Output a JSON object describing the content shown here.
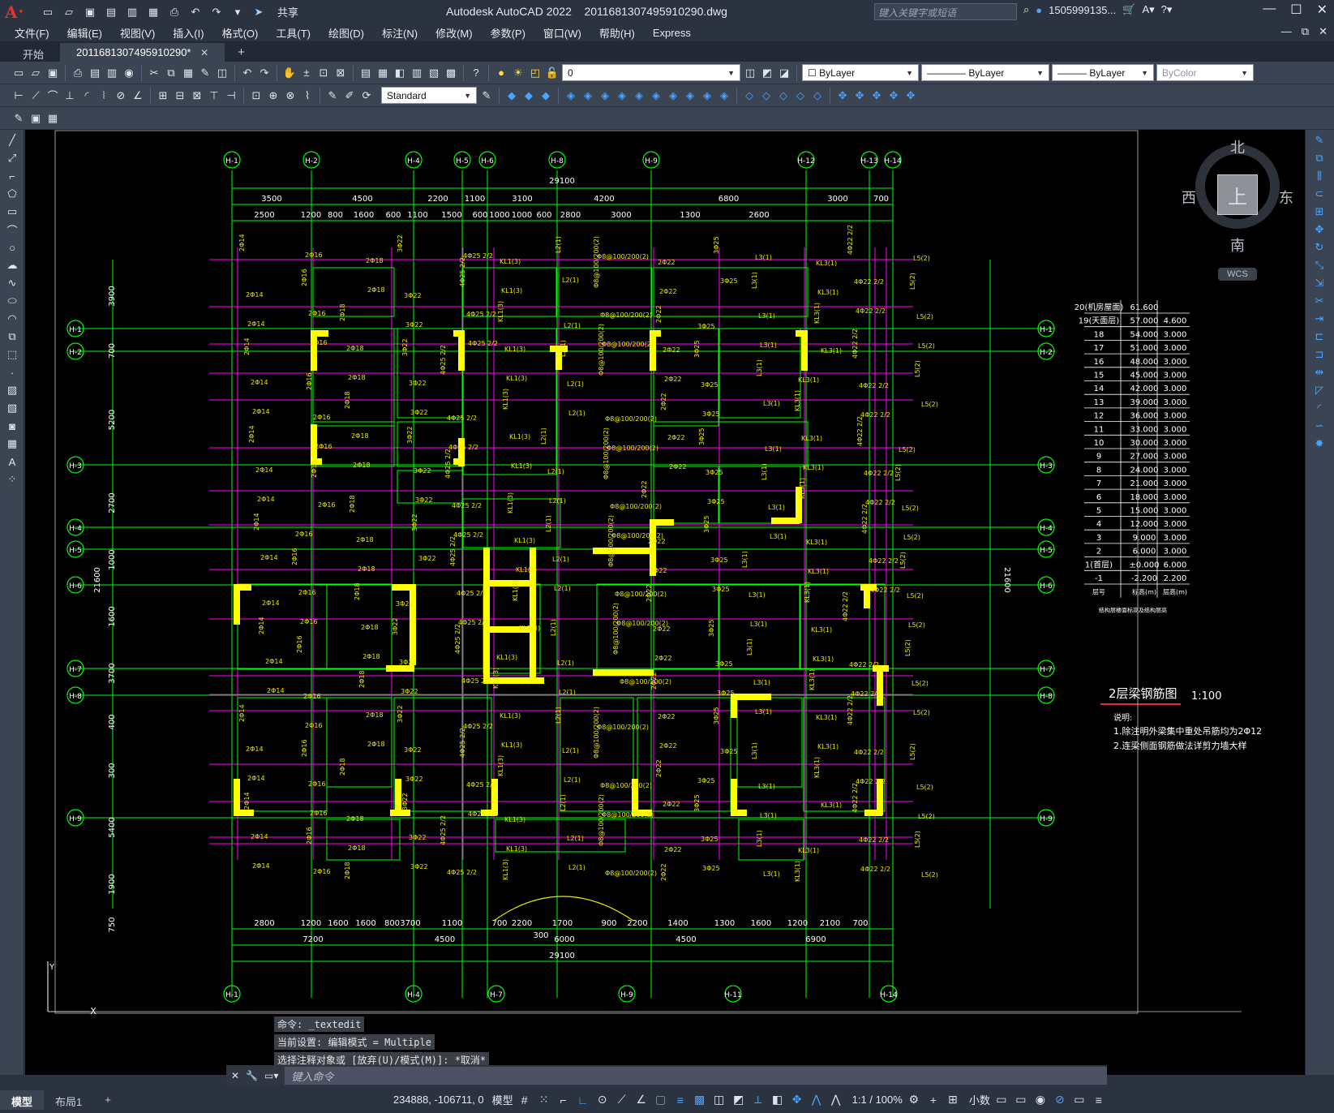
{
  "title_bar": {
    "app_title": "Autodesk AutoCAD 2022",
    "file_name": "2011681307495910290.dwg",
    "share_label": "共享",
    "search_placeholder": "键入关键字或短语",
    "user_name": "1505999135..."
  },
  "menu": {
    "items": [
      "文件(F)",
      "编辑(E)",
      "视图(V)",
      "插入(I)",
      "格式(O)",
      "工具(T)",
      "绘图(D)",
      "标注(N)",
      "修改(M)",
      "参数(P)",
      "窗口(W)",
      "帮助(H)",
      "Express"
    ]
  },
  "tabs": {
    "start": "开始",
    "drawing": "2011681307495910290*",
    "close": "✕",
    "add": "+"
  },
  "layers": {
    "current_layer": "0",
    "color": "ByLayer",
    "linetype": "ByLayer",
    "lineweight": "ByLayer",
    "plotstyle": "ByColor",
    "dimstyle": "Standard"
  },
  "viewcube": {
    "north": "北",
    "south": "南",
    "east": "东",
    "west": "西",
    "top": "上",
    "wcs": "WCS"
  },
  "drawing": {
    "axis_labels_top": [
      "H-1",
      "H-2",
      "H-4",
      "H-5",
      "H-6",
      "H-8",
      "H-9",
      "H-12",
      "H-13",
      "H-14"
    ],
    "axis_labels_bottom": [
      "H-1",
      "H-4",
      "H-7",
      "H-9",
      "H-11",
      "H-14"
    ],
    "axis_labels_left": [
      "H-1",
      "H-2",
      "H-3",
      "H-4",
      "H-5",
      "H-6",
      "H-7",
      "H-8",
      "H-9"
    ],
    "top_total": "29100",
    "top_dims_1": [
      "3500",
      "4500",
      "2200",
      "1100",
      "3100",
      "4200",
      "6800",
      "3000",
      "700"
    ],
    "top_dims_2": [
      "2500",
      "1200",
      "800",
      "1600",
      "600",
      "1100",
      "1500",
      "600",
      "1000",
      "1000",
      "600",
      "2800",
      "3000",
      "1300",
      "2600"
    ],
    "bottom_dims_1": [
      "2800",
      "1200",
      "1600",
      "1600",
      "800",
      "3700",
      "1100",
      "700",
      "2200",
      "1700",
      "900",
      "2200",
      "1400",
      "1300",
      "1600",
      "1200",
      "2100",
      "700"
    ],
    "bottom_dims_2": [
      "7200",
      "4500",
      "6000",
      "4500",
      "6900"
    ],
    "bottom_mid": "300",
    "bottom_total": "29100",
    "left_dims": [
      "3900",
      "700",
      "5200",
      "2700",
      "1000",
      "1600",
      "3700",
      "400",
      "300",
      "5400",
      "1900",
      "750"
    ],
    "left_total": "21600",
    "right_total": "21600",
    "title_text": "2层梁钢筋图",
    "title_scale": "1:100",
    "notes_heading": "说明:",
    "notes": [
      "1.除注明外梁集中重处吊筋均为2Φ12",
      "2.连梁侧面钢筋做法详剪力墙大样"
    ],
    "floor_table": {
      "rows": [
        [
          "20(机房屋面)",
          "61.600",
          ""
        ],
        [
          "19(天面层)",
          "57.000",
          "4.600"
        ],
        [
          "18",
          "54.000",
          "3.000"
        ],
        [
          "17",
          "51.000",
          "3.000"
        ],
        [
          "16",
          "48.000",
          "3.000"
        ],
        [
          "15",
          "45.000",
          "3.000"
        ],
        [
          "14",
          "42.000",
          "3.000"
        ],
        [
          "13",
          "39.000",
          "3.000"
        ],
        [
          "12",
          "36.000",
          "3.000"
        ],
        [
          "11",
          "33.000",
          "3.000"
        ],
        [
          "10",
          "30.000",
          "3.000"
        ],
        [
          "9",
          "27.000",
          "3.000"
        ],
        [
          "8",
          "24.000",
          "3.000"
        ],
        [
          "7",
          "21.000",
          "3.000"
        ],
        [
          "6",
          "18.000",
          "3.000"
        ],
        [
          "5",
          "15.000",
          "3.000"
        ],
        [
          "4",
          "12.000",
          "3.000"
        ],
        [
          "3",
          "9.000",
          "3.000"
        ],
        [
          "2",
          "6.000",
          "3.000"
        ],
        [
          "1(首层)",
          "±0.000",
          "6.000"
        ],
        [
          "-1",
          "-2.200",
          "2.200"
        ]
      ],
      "footer": [
        "层号",
        "标高(m)",
        "层高(m)"
      ],
      "caption": "结构层楼面标高及结构层高"
    }
  },
  "command": {
    "history": [
      "命令: _textedit",
      "当前设置: 编辑模式 = Multiple",
      "选择注释对象或 [放弃(U)/模式(M)]: *取消*"
    ],
    "placeholder": "键入命令"
  },
  "status": {
    "layout_tabs": [
      "模型",
      "布局1"
    ],
    "add_layout": "+",
    "coordinates": "234888, -106711, 0",
    "model_label": "模型",
    "annotation_scale": "1:1 / 100%",
    "units": "小数"
  },
  "colors": {
    "accent": "#4aa3ff",
    "canvas": "#000000",
    "axis_green": "#00ff00",
    "beam_magenta": "#ff00ff",
    "wall_yellow": "#ffff00",
    "text_yellow": "#e8e800"
  }
}
